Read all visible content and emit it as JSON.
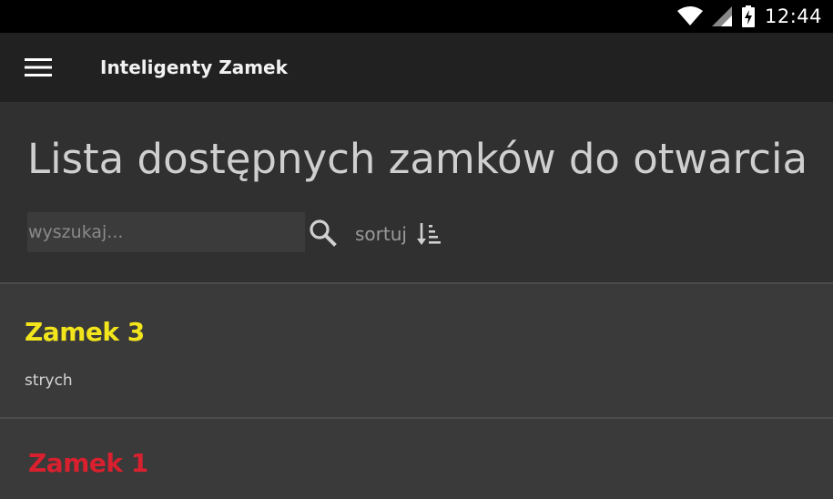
{
  "status_bar": {
    "time": "12:44",
    "icons": [
      "wifi-icon",
      "signal-icon",
      "battery-charging-icon"
    ]
  },
  "app_bar": {
    "menu_icon": "hamburger-menu-icon",
    "title": "Inteligenty Zamek"
  },
  "header": {
    "title": "Lista dostępnych zamków do otwarcia",
    "search": {
      "placeholder": "wyszukaj...",
      "value": "",
      "icon": "search-icon"
    },
    "sort": {
      "label": "sortuj",
      "icon": "sort-icon"
    }
  },
  "locks": [
    {
      "name": "Zamek 3",
      "place": "strych",
      "color": "#f2e51c"
    },
    {
      "name": "Zamek 1",
      "place": "",
      "color": "#d8202e"
    }
  ],
  "colors": {
    "status_bar": "#000000",
    "app_bar": "#212121",
    "header": "#303030",
    "list_background": "#3a3a3a"
  }
}
